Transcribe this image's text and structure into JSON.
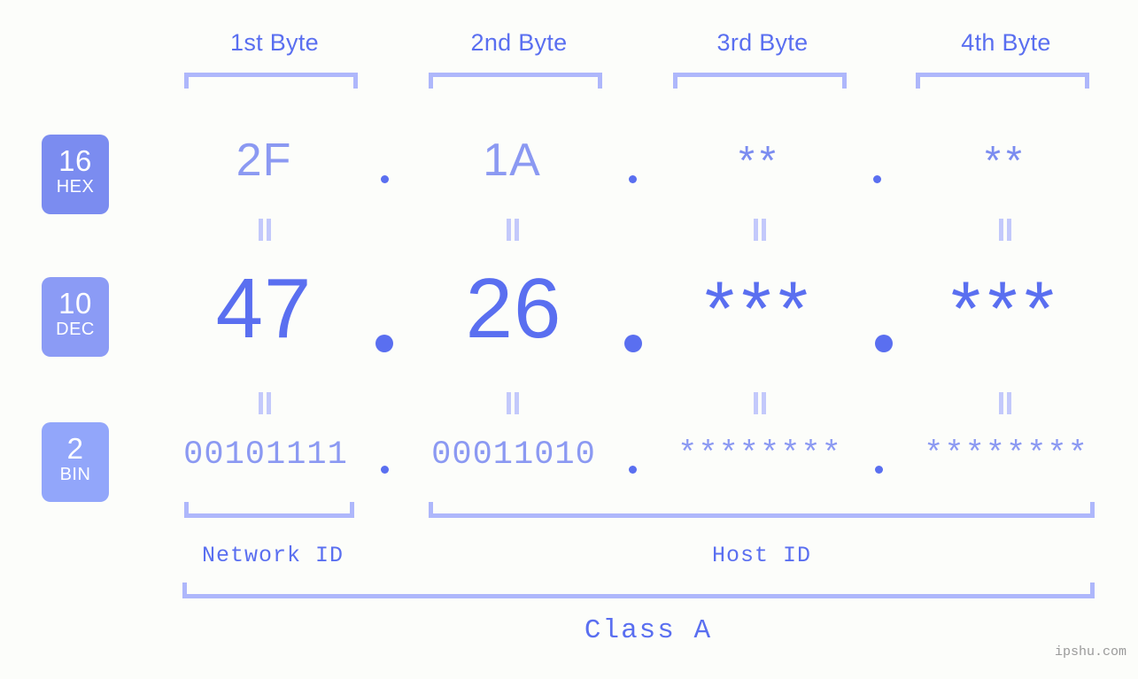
{
  "headers": [
    {
      "label": "1st Byte"
    },
    {
      "label": "2nd Byte"
    },
    {
      "label": "3rd Byte"
    },
    {
      "label": "4th Byte"
    }
  ],
  "bases": [
    {
      "number": "16",
      "name": "HEX",
      "color": "#7b8cf0"
    },
    {
      "number": "10",
      "name": "DEC",
      "color": "#8b9bf5"
    },
    {
      "number": "2",
      "name": "BIN",
      "color": "#92a6fa"
    }
  ],
  "rows": {
    "hex": {
      "base_number": "16",
      "base_name": "HEX",
      "values": [
        "2F",
        "1A",
        "**",
        "**"
      ],
      "separator": "."
    },
    "dec": {
      "base_number": "10",
      "base_name": "DEC",
      "values": [
        "47",
        "26",
        "***",
        "***"
      ],
      "separator": "."
    },
    "bin": {
      "base_number": "2",
      "base_name": "BIN",
      "values": [
        "00101111",
        "00011010",
        "********",
        "********"
      ],
      "separator": "."
    }
  },
  "equals_mark": "=",
  "segments": {
    "network_id": "Network ID",
    "host_id": "Host ID",
    "class": "Class A"
  },
  "watermark": "ipshu.com",
  "colors": {
    "background": "#fcfdfa",
    "accent_strong": "#5a6ff0",
    "accent_mid": "#8b99f2",
    "accent_light": "#aeb7fb",
    "equals": "#c3c9fb",
    "watermark": "#9a9a9a"
  }
}
